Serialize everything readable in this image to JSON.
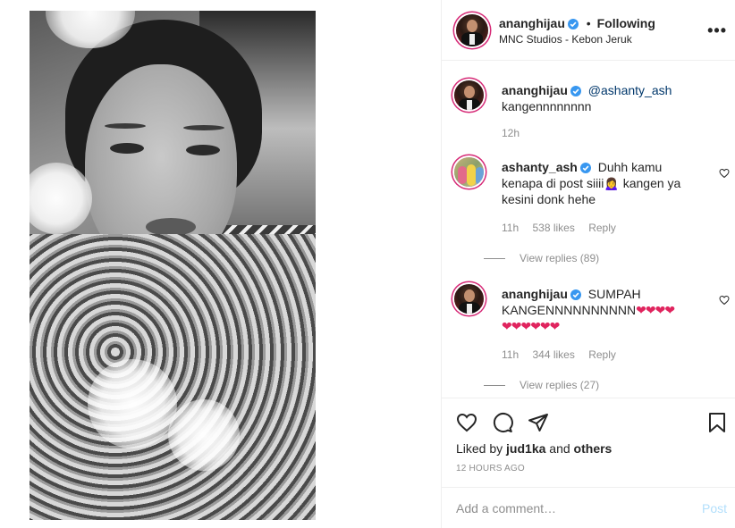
{
  "post": {
    "author": "ananghijau",
    "following_label": "Following",
    "separator": "•",
    "location": "MNC Studios - Kebon Jeruk"
  },
  "comments": [
    {
      "author": "ananghijau",
      "mention": "@ashanty_ash",
      "text": "kangennnnnnnn",
      "time": "12h"
    },
    {
      "author": "ashanty_ash",
      "text": "Duhh kamu kenapa di post siiii🙍‍♀️ kangen ya kesini donk hehe",
      "time": "11h",
      "likes": "538 likes",
      "reply_label": "Reply",
      "view_replies": "View replies (89)"
    },
    {
      "author": "ananghijau",
      "text": "SUMPAH KANGENNNNNNNNNN",
      "hearts_line1": "❤❤❤❤",
      "hearts_line2": "❤❤❤❤❤❤",
      "time": "11h",
      "likes": "344 likes",
      "reply_label": "Reply",
      "view_replies": "View replies (27)"
    }
  ],
  "likes": {
    "prefix": "Liked by",
    "user": "jud1ka",
    "conjunction": "and",
    "others": "others"
  },
  "timestamp": "12 HOURS AGO",
  "comment_box": {
    "placeholder": "Add a comment…",
    "post_label": "Post"
  },
  "colors": {
    "verified": "#3897f0",
    "link": "#00376b",
    "muted": "#8e8e8e",
    "post_disabled": "#b2dffc",
    "heart": "#e0245e"
  },
  "icons": [
    "verified-badge-icon",
    "more-options-icon",
    "heart-icon",
    "comment-icon",
    "share-icon",
    "bookmark-icon",
    "comment-like-icon"
  ]
}
